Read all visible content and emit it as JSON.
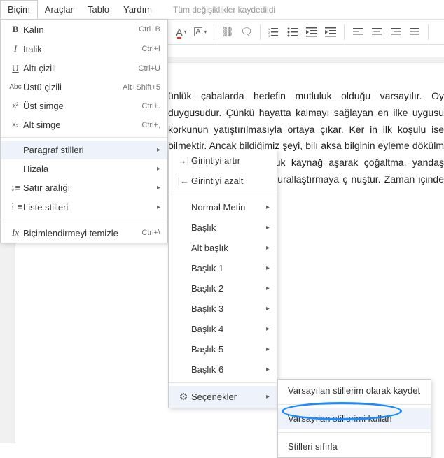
{
  "menubar": {
    "items": [
      "Biçim",
      "Araçlar",
      "Tablo",
      "Yardım"
    ],
    "status": "Tüm değişiklikler kaydedildi"
  },
  "dropdown1": {
    "sections": [
      [
        {
          "icon": "B",
          "iconClass": "icon-bold",
          "label": "Kalın",
          "shortcut": "Ctrl+B"
        },
        {
          "icon": "I",
          "iconClass": "icon-italic",
          "label": "İtalik",
          "shortcut": "Ctrl+I"
        },
        {
          "icon": "U",
          "iconClass": "icon-underline",
          "label": "Altı çizili",
          "shortcut": "Ctrl+U"
        },
        {
          "icon": "Abc",
          "iconClass": "icon-strike",
          "label": "Üstü çizili",
          "shortcut": "Alt+Shift+5"
        },
        {
          "icon": "x²",
          "iconClass": "icon-sup",
          "label": "Üst simge",
          "shortcut": "Ctrl+."
        },
        {
          "icon": "x₂",
          "iconClass": "icon-sub",
          "label": "Alt simge",
          "shortcut": "Ctrl+,"
        }
      ],
      [
        {
          "icon": "",
          "label": "Paragraf stilleri",
          "submenu": true,
          "highlighted": true
        },
        {
          "icon": "",
          "label": "Hizala",
          "submenu": true
        },
        {
          "icon": "↕≡",
          "label": "Satır aralığı",
          "submenu": true
        },
        {
          "icon": "⋮≡",
          "label": "Liste stilleri",
          "submenu": true
        }
      ],
      [
        {
          "icon": "Ix",
          "iconClass": "icon-italic",
          "label": "Biçimlendirmeyi temizle",
          "shortcut": "Ctrl+\\"
        }
      ]
    ]
  },
  "dropdown2": {
    "sections": [
      [
        {
          "icon": "→|",
          "label": "Girintiyi artır"
        },
        {
          "icon": "|←",
          "label": "Girintiyi azalt"
        }
      ],
      [
        {
          "label": "Normal Metin",
          "submenu": true
        },
        {
          "label": "Başlık",
          "submenu": true
        },
        {
          "label": "Alt başlık",
          "submenu": true
        },
        {
          "label": "Başlık 1",
          "submenu": true
        },
        {
          "label": "Başlık 2",
          "submenu": true
        },
        {
          "label": "Başlık 3",
          "submenu": true
        },
        {
          "label": "Başlık 4",
          "submenu": true
        },
        {
          "label": "Başlık 5",
          "submenu": true
        },
        {
          "label": "Başlık 6",
          "submenu": true
        }
      ],
      [
        {
          "icon": "⚙",
          "iconClass": "icon-gear",
          "label": "Seçenekler",
          "submenu": true,
          "highlighted": true
        }
      ]
    ]
  },
  "dropdown3": {
    "items": [
      {
        "label": "Varsayılan stillerim olarak kaydet"
      },
      {
        "label": "Varsayılan stillerimi kullan",
        "highlighted": true
      },
      {
        "label": "Stilleri sıfırla"
      }
    ]
  },
  "document": {
    "text": "ünlük çabalarda hedefin mutluluk olduğu varsayılır. Oy duygusudur.   Çünkü hayatta kalmayı sağlayan en ilke uygusu korkunun yatıştırılmasıyla ortaya çıkar. Ker in ilk koşulu ise bilmektir. Ancak bildiğimiz şeyi, bilı aksa bilginin eyleme dökülm lgi bizim için huzursuzluk kaynağ aşarak çoğaltma, yandaş oluşturn muz davranışı kurallaştırmaya ç nuştur. Zaman içinde altta yatan b"
  }
}
